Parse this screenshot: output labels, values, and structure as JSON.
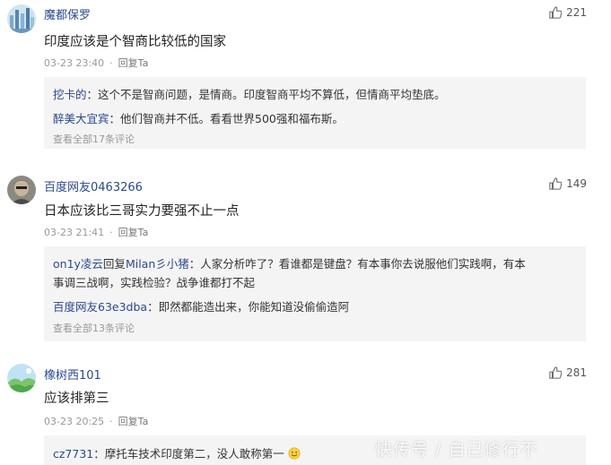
{
  "comments": [
    {
      "username": "魔都保罗",
      "likes": "221",
      "text": "印度应该是个智商比较低的国家",
      "time": "03-23 23:40",
      "reply_label": "回复Ta",
      "replies": [
        {
          "name": "挖卡的",
          "text": "：这个不是智商问题，是情商。印度智商平均不算低，但情商平均垫底。"
        },
        {
          "name": "醉美大宜宾",
          "text": "：他们智商并不低。看看世界500强和福布斯。"
        }
      ],
      "more": "查看全部17条评论"
    },
    {
      "username": "百度网友0463266",
      "likes": "149",
      "text": "日本应该比三哥实力要强不止一点",
      "time": "03-23 21:41",
      "reply_label": "回复Ta",
      "replies": [
        {
          "name": "on1y凌云",
          "mid": "回复",
          "target": "Milan彡小猪",
          "text": "：人家分析咋了？看谁都是键盘？有本事你去说服他们实践啊，有本",
          "text2": "事调三战啊，实践检验？战争谁都打不起"
        },
        {
          "name": "百度网友63e3dba",
          "text": "：即然都能造出来，你能知道没偷偷造阿"
        }
      ],
      "more": "查看全部13条评论"
    },
    {
      "username": "橡树西101",
      "likes": "281",
      "text": "应该排第三",
      "time": "03-23 20:25",
      "reply_label": "回复Ta",
      "replies": [
        {
          "name": "cz7731",
          "text": "：摩托车技术印度第二，没人敢称第一"
        }
      ]
    }
  ],
  "watermark": "快传号 / 自己修行不",
  "icons": {
    "like": "thumbs-up-icon",
    "emoji": "smile-emoji-icon"
  }
}
